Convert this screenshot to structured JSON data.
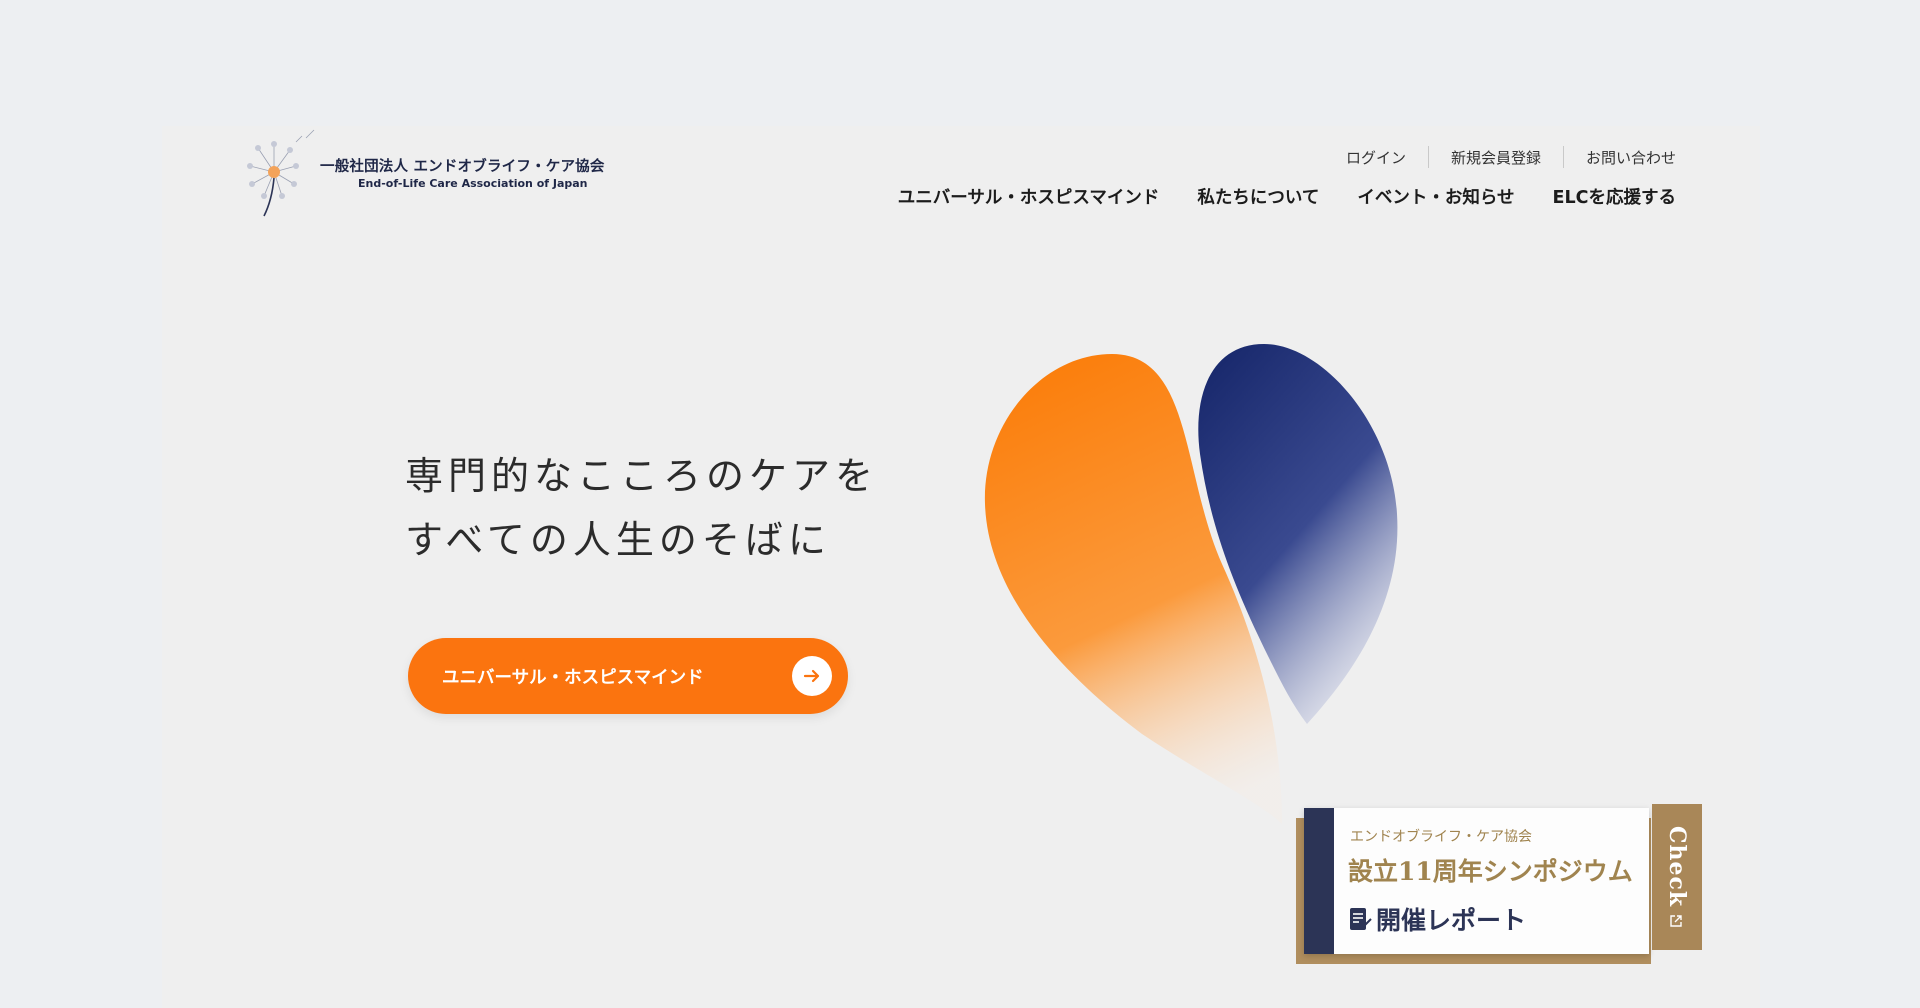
{
  "logo": {
    "name_jp": "一般社団法人 エンドオブライフ・ケア協会",
    "name_en": "End-of-Life Care Association of Japan",
    "icon": "dandelion-icon"
  },
  "util_nav": {
    "login": "ログイン",
    "register": "新規会員登録",
    "contact": "お問い合わせ"
  },
  "main_nav": {
    "items": [
      "ユニバーサル・ホスピスマインド",
      "私たちについて",
      "イベント・お知らせ",
      "ELCを応援する"
    ]
  },
  "hero": {
    "title_line1": "専門的なこころのケアを",
    "title_line2": "すべての人生のそばに",
    "cta_label": "ユニバーサル・ホスピスマインド",
    "cta_icon": "arrow-right-icon"
  },
  "banner": {
    "subtitle": "エンドオブライフ・ケア協会",
    "title": "設立11周年シンポジウム",
    "report": "開催レポート",
    "check": "Check",
    "report_icon": "document-icon",
    "check_icon": "external-link-icon"
  },
  "colors": {
    "accent_orange": "#fb740f",
    "navy": "#2c3456",
    "gold": "#a98758",
    "page_bg": "#efefef"
  }
}
